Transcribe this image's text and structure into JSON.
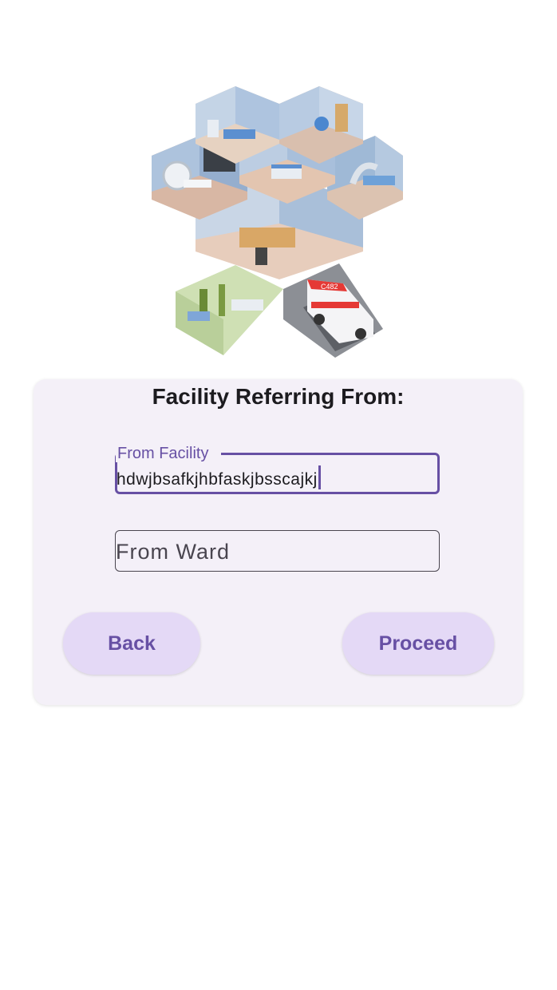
{
  "form": {
    "title": "Facility Referring From:",
    "from_facility": {
      "label": "From Facility",
      "value": "hdwjbsafkjhbfaskjbsscajkj"
    },
    "from_ward": {
      "placeholder": "From Ward"
    },
    "back_label": "Back",
    "proceed_label": "Proceed"
  },
  "colors": {
    "primary": "#6750a4",
    "button_bg": "#e4d9f6",
    "card_bg": "#f4f0f8"
  },
  "illustration": {
    "icon": "hospital-isometric-illustration",
    "ambulance_text": "C482"
  }
}
